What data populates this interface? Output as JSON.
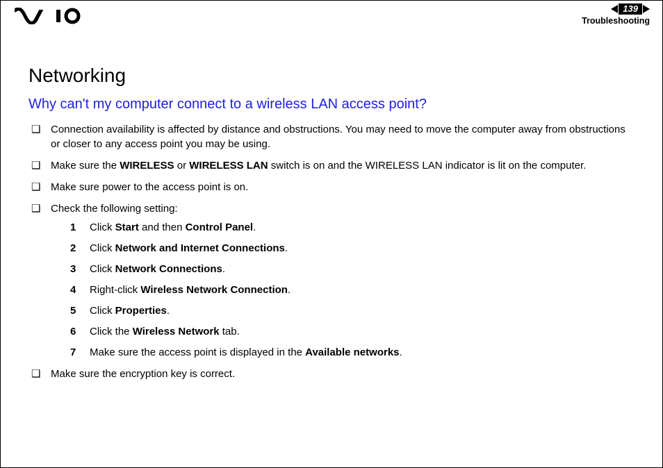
{
  "header": {
    "page_number": "139",
    "section": "Troubleshooting"
  },
  "content": {
    "h1": "Networking",
    "h2": "Why can't my computer connect to a wireless LAN access point?",
    "bullets": [
      {
        "html": "Connection availability is affected by distance and obstructions. You may need to move the computer away from obstructions or closer to any access point you may be using."
      },
      {
        "html": "Make sure the <b>WIRELESS</b> or <b>WIRELESS LAN</b> switch is on and the WIRELESS LAN indicator is lit on the computer."
      },
      {
        "html": "Make sure power to the access point is on."
      },
      {
        "html": "Check the following setting:",
        "steps": [
          "Click <b>Start</b> and then <b>Control Panel</b>.",
          "Click <b>Network and Internet Connections</b>.",
          "Click <b>Network Connections</b>.",
          "Right-click <b>Wireless Network Connection</b>.",
          "Click <b>Properties</b>.",
          "Click the <b>Wireless Network</b> tab.",
          "Make sure the access point is displayed in the <b>Available networks</b>."
        ]
      },
      {
        "html": "Make sure the encryption key is correct."
      }
    ]
  }
}
